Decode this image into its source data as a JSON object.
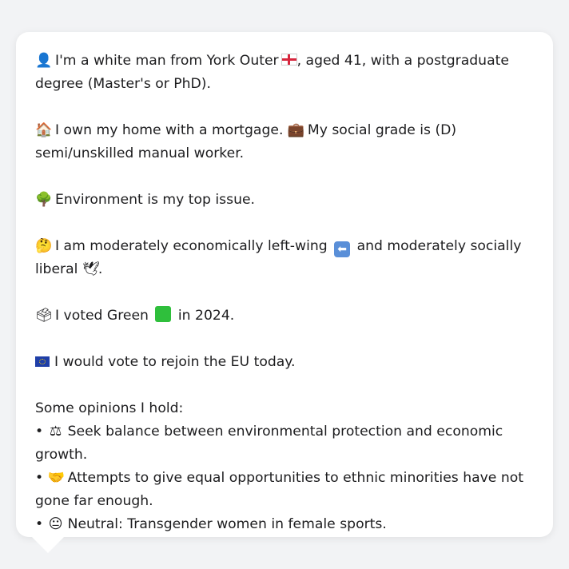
{
  "card": {
    "intro": {
      "icon": "person-silhouette-icon",
      "text_a": "I'm a white man from York Outer",
      "text_b": ", aged 41, with a postgraduate degree (Master's or PhD)."
    },
    "home": {
      "icon": "house-icon",
      "text_a": "I own my home with a mortgage.",
      "icon2": "briefcase-icon",
      "text_b": "My social grade is (D) semi/unskilled manual worker."
    },
    "issue": {
      "icon": "tree-icon",
      "text": "Environment is my top issue."
    },
    "ideology": {
      "icon": "thinking-face-icon",
      "text_a": "I am moderately economically left-wing",
      "text_b": "and moderately socially liberal",
      "text_c": "."
    },
    "vote": {
      "icon": "ballot-box-icon",
      "text_a": "I voted Green",
      "text_b": "in 2024."
    },
    "eu": {
      "icon": "eu-flag-icon",
      "text": "I would vote to rejoin the EU today."
    },
    "opinions": {
      "heading": "Some opinions I hold:",
      "bullet": "•",
      "items": [
        {
          "icon": "scales-icon",
          "text": "Seek balance between environmental protection and economic growth."
        },
        {
          "icon": "handshake-icon",
          "text": "Attempts to give equal opportunities to ethnic minorities have not gone far enough."
        },
        {
          "icon": "neutral-face-icon",
          "text": "Neutral: Transgender women in female sports."
        }
      ]
    }
  },
  "colors": {
    "background": "#f2f3f5",
    "card": "#ffffff",
    "text": "#1d1d1f"
  }
}
